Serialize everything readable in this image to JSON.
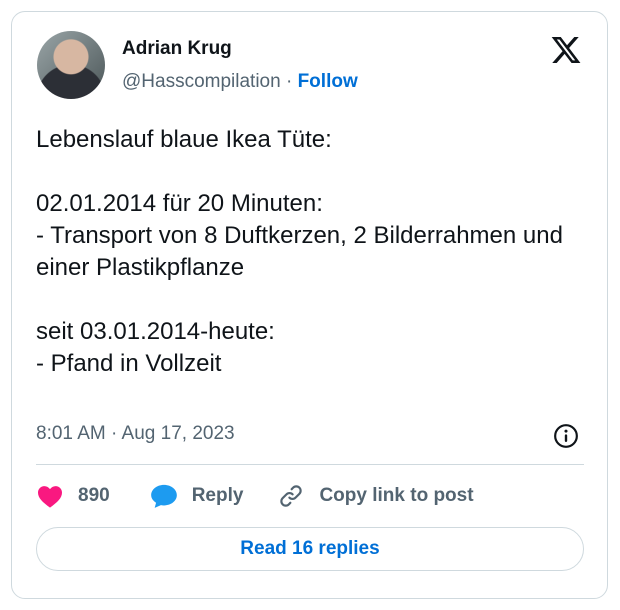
{
  "author": {
    "name": "Adrian Krug",
    "handle": "@Hasscompilation",
    "separator": "·",
    "follow_label": "Follow"
  },
  "tweet": {
    "text": "Lebenslauf blaue Ikea Tüte:\n\n02.01.2014 für 20 Minuten:\n- Transport von 8 Duftkerzen, 2 Bilderrahmen und einer Plastikpflanze\n\nseit 03.01.2014-heute:\n- Pfand in Vollzeit",
    "timestamp": "8:01 AM · Aug 17, 2023"
  },
  "actions": {
    "likes": "890",
    "reply_label": "Reply",
    "copy_label": "Copy link to post"
  },
  "replies_button": "Read 16 replies",
  "icons": {
    "logo": "x-logo-icon",
    "info": "info-icon",
    "like": "heart-icon",
    "reply": "speech-bubble-icon",
    "copy": "link-icon"
  },
  "colors": {
    "accent": "#006fd6",
    "like": "#f91880",
    "reply": "#1d9bf0",
    "muted": "#536471",
    "border": "#cfd9de"
  }
}
